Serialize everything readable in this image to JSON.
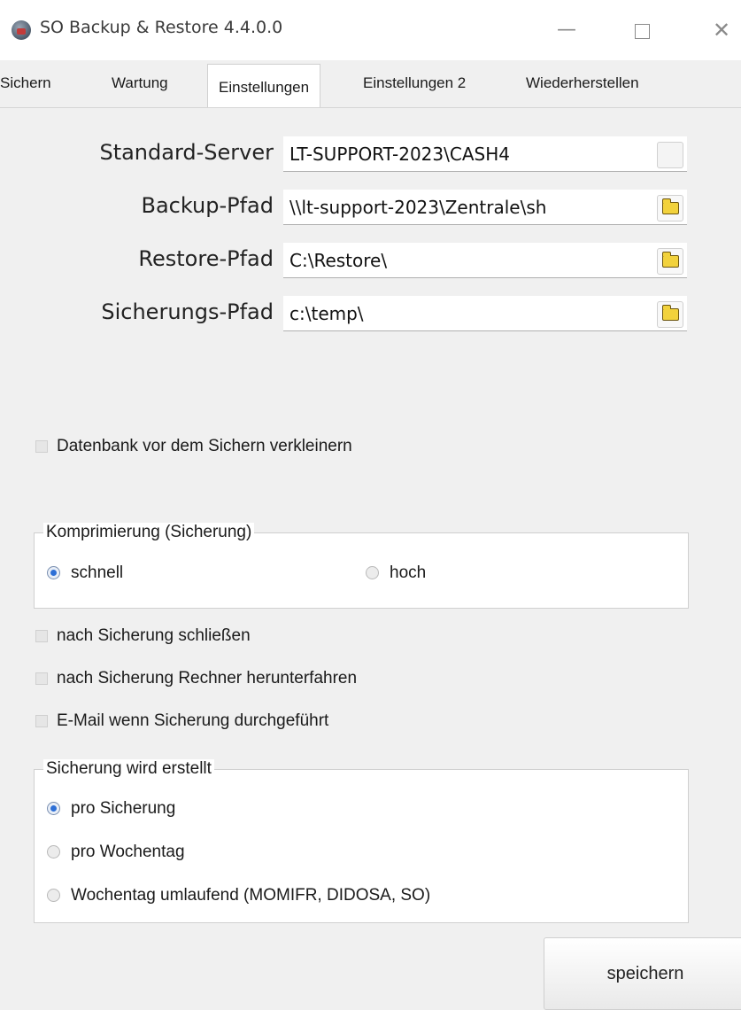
{
  "window": {
    "title": "SO Backup & Restore 4.4.0.0",
    "minimize_glyph": "—",
    "close_glyph": "✕"
  },
  "tabs": [
    {
      "label": "Sichern",
      "active": false
    },
    {
      "label": "Wartung",
      "active": false
    },
    {
      "label": "Einstellungen",
      "active": true
    },
    {
      "label": "Einstellungen 2",
      "active": false
    },
    {
      "label": "Wiederherstellen",
      "active": false
    }
  ],
  "settings": {
    "server_label": "Standard-Server",
    "server_value": "LT-SUPPORT-2023\\CASH4",
    "backup_label": "Backup-Pfad",
    "backup_value": "\\\\lt-support-2023\\Zentrale\\sh",
    "restore_label": "Restore-Pfad",
    "restore_value": "C:\\Restore\\",
    "sicherung_label": "Sicherungs-Pfad",
    "sicherung_value": "c:\\temp\\"
  },
  "checkboxes": {
    "shrink": {
      "label": "Datenbank vor dem Sichern verkleinern",
      "checked": false
    },
    "close_after": {
      "label": "nach Sicherung schließen",
      "checked": false
    },
    "shutdown_after": {
      "label": "nach Sicherung Rechner herunterfahren",
      "checked": false
    },
    "email_after": {
      "label": "E-Mail wenn Sicherung durchgeführt",
      "checked": false
    }
  },
  "compression": {
    "legend": "Komprimierung (Sicherung)",
    "options": [
      {
        "label": "schnell",
        "selected": true
      },
      {
        "label": "hoch",
        "selected": false
      }
    ]
  },
  "backup_mode": {
    "legend": "Sicherung wird erstellt",
    "options": [
      {
        "label": "pro Sicherung",
        "selected": true
      },
      {
        "label": "pro Wochentag",
        "selected": false
      },
      {
        "label": "Wochentag umlaufend (MOMIFR, DIDOSA, SO)",
        "selected": false
      }
    ]
  },
  "save_button": "speichern",
  "colors": {
    "radio_selected": "#2d6fd6",
    "folder_icon": "#f2d23c",
    "window_bg": "#f0f0f0"
  }
}
